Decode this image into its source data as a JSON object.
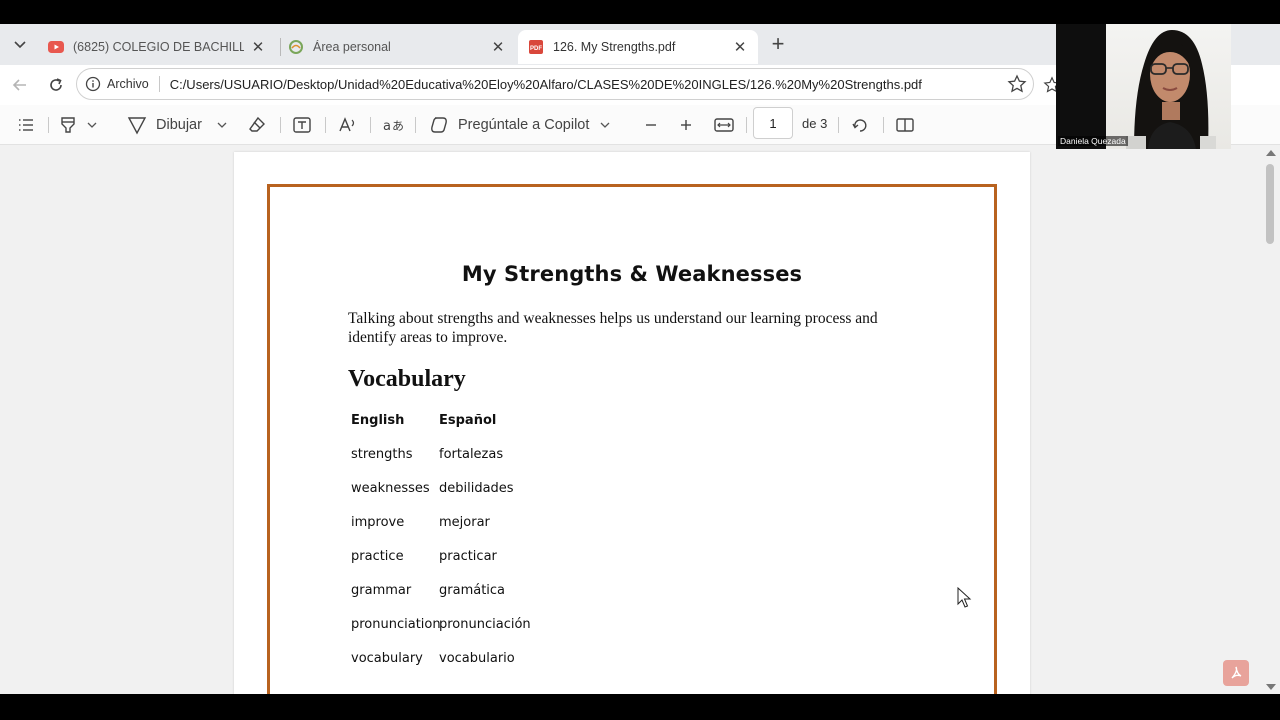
{
  "tabs": [
    {
      "title": "(6825) COLEGIO DE BACHILLERATO",
      "active": false
    },
    {
      "title": "Área personal",
      "active": false
    },
    {
      "title": "126. My Strengths.pdf",
      "active": true
    }
  ],
  "address": {
    "scheme_label": "Archivo",
    "url": "C:/Users/USUARIO/Desktop/Unidad%20Educativa%20Eloy%20Alfaro/CLASES%20DE%20INGLES/126.%20My%20Strengths.pdf"
  },
  "pdf_toolbar": {
    "draw_label": "Dibujar",
    "copilot_label": "Pregúntale a Copilot",
    "page_current": "1",
    "page_total": "de 3"
  },
  "document": {
    "title": "My Strengths & Weaknesses",
    "intro": "Talking about strengths and weaknesses helps us understand our learning process and identify areas to improve.",
    "section_heading": "Vocabulary",
    "vocab_headers": {
      "english": "English",
      "spanish": "Español"
    },
    "vocab": [
      {
        "english": "strengths",
        "spanish": "fortalezas"
      },
      {
        "english": "weaknesses",
        "spanish": "debilidades"
      },
      {
        "english": "improve",
        "spanish": "mejorar"
      },
      {
        "english": "practice",
        "spanish": "practicar"
      },
      {
        "english": "grammar",
        "spanish": "gramática"
      },
      {
        "english": "pronunciation",
        "spanish": "pronunciación"
      },
      {
        "english": "vocabulary",
        "spanish": "vocabulario"
      }
    ]
  },
  "webcam": {
    "participant_name": "Daniela Quezada"
  },
  "colors": {
    "page_border": "#b8621f",
    "tab_active": "#ffffff",
    "youtube_red": "#e8584f"
  }
}
